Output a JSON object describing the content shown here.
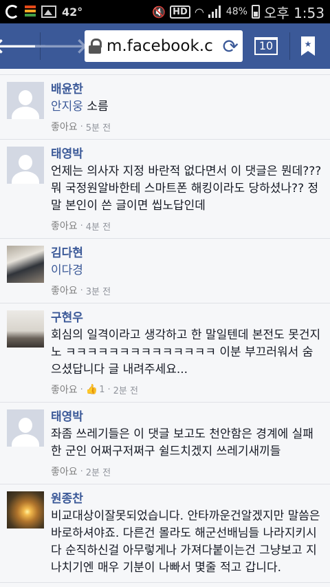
{
  "status_bar": {
    "temperature": "42°",
    "hd": "HD",
    "battery": "48%",
    "time": "오후 1:53"
  },
  "toolbar": {
    "back_icon": "arrow-left-icon",
    "forward_icon": "arrow-right-icon",
    "url": "m.facebook.c",
    "tab_count": "10"
  },
  "comments": [
    {
      "name": "배윤한",
      "text_tag": "안지웅",
      "text": "소름",
      "like": "좋아요",
      "time": "5분 전",
      "avatar": "silhouette"
    },
    {
      "name": "태영박",
      "text_tag": "",
      "text": "언제는 의사자 지정 바란적 없다면서 이 댓글은 뭔데??? 뭐 국정원알바한테 스마트폰 해킹이라도 당하셨나?? 정말 본인이 쓴 글이면 씹노답인데",
      "like": "좋아요",
      "time": "4분 전",
      "avatar": "silhouette"
    },
    {
      "name": "김다현",
      "text_tag": "이다경",
      "text": "",
      "like": "좋아요",
      "time": "3분 전",
      "avatar": "photo1"
    },
    {
      "name": "구현우",
      "text_tag": "",
      "text": "회심의 일격이라고 생각하고 한 말일텐데 본전도 못건지노 ㅋㅋㅋㅋㅋㅋㅋㅋㅋㅋㅋㅋㅋㅋ 이분 부끄러워서 숨으셨답니다 글 내려주세요...",
      "like": "좋아요",
      "likes_count": "1",
      "time": "2분 전",
      "avatar": "photo2"
    },
    {
      "name": "태영박",
      "text_tag": "",
      "text": "좌좀 쓰레기들은 이 댓글 보고도 천안함은 경계에 실패한 군인 어쩌구저쩌구 쉴드치겠지 쓰레기새끼들",
      "like": "좋아요",
      "time": "2분 전",
      "avatar": "silhouette"
    },
    {
      "name": "원종찬",
      "text_tag": "",
      "text": "비교대상이잘못되었습니다. 안타까운건알겠지만 말씀은 바로하셔야죠. 다른건 몰라도 해군선배님들 나라지키시다 순직하신걸 아무렇게나 가져다붙이는건 그냥보고 지나치기엔 매우 기분이 나빠서 몇줄 적고 갑니다.",
      "like": "",
      "time": "",
      "avatar": "photo3"
    }
  ]
}
